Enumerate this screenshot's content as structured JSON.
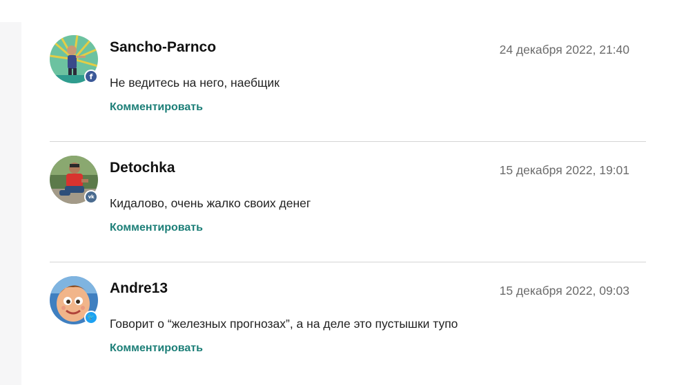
{
  "comments": [
    {
      "author": "Sancho-Parnco",
      "date": "24 декабря 2022, 21:40",
      "text": "Не ведитесь на него, наебщик",
      "reply_label": "Комментировать",
      "social_network": "facebook",
      "badge_glyph": "f"
    },
    {
      "author": "Detochka",
      "date": "15 декабря 2022, 19:01",
      "text": "Кидалово, очень жалко своих денег",
      "reply_label": "Комментировать",
      "social_network": "vk",
      "badge_glyph": "vk"
    },
    {
      "author": "Andre13",
      "date": "15 декабря 2022, 09:03",
      "text": "Говорит о “железных прогнозах”, а на деле это пустышки тупо",
      "reply_label": "Комментировать",
      "social_network": "twitter",
      "badge_glyph": "🐦"
    }
  ],
  "colors": {
    "link": "#1d7f78",
    "facebook": "#3b5998",
    "vk": "#4a6b8f",
    "twitter": "#1da1f2"
  }
}
